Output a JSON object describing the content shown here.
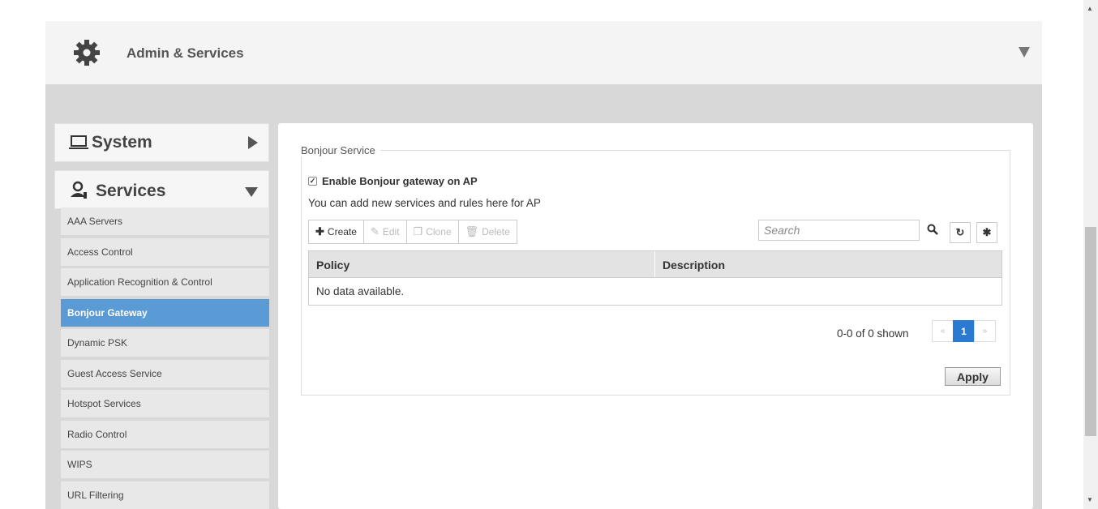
{
  "header": {
    "title": "Admin & Services",
    "icon": "gear-icon",
    "collapse_icon": "chevron-down-icon"
  },
  "sidebar": {
    "system": {
      "label": "System",
      "icon": "laptop-icon"
    },
    "services": {
      "label": "Services",
      "icon": "services-icon"
    },
    "items": [
      {
        "label": "AAA Servers"
      },
      {
        "label": "Access Control"
      },
      {
        "label": "Application Recognition & Control"
      },
      {
        "label": "Bonjour Gateway",
        "active": true
      },
      {
        "label": "Dynamic PSK"
      },
      {
        "label": "Guest Access Service"
      },
      {
        "label": "Hotspot Services"
      },
      {
        "label": "Radio Control"
      },
      {
        "label": "WIPS"
      },
      {
        "label": "URL Filtering"
      }
    ]
  },
  "main": {
    "section_title": "Bonjour Service",
    "enable_label": "Enable Bonjour gateway on AP",
    "enable_checked": true,
    "help_text": "You can add new services and rules here for AP",
    "toolbar": {
      "create": "Create",
      "edit": "Edit",
      "clone": "Clone",
      "delete": "Delete"
    },
    "search": {
      "placeholder": "Search"
    },
    "table": {
      "columns": [
        "Policy",
        "Description"
      ],
      "empty_text": "No data available."
    },
    "pagination": {
      "shown_text": "0-0 of 0 shown",
      "prev": "«",
      "current": "1",
      "next": "»"
    },
    "apply_label": "Apply"
  },
  "colors": {
    "active_item": "#5b9bd5",
    "page_current": "#2a7ad1"
  }
}
